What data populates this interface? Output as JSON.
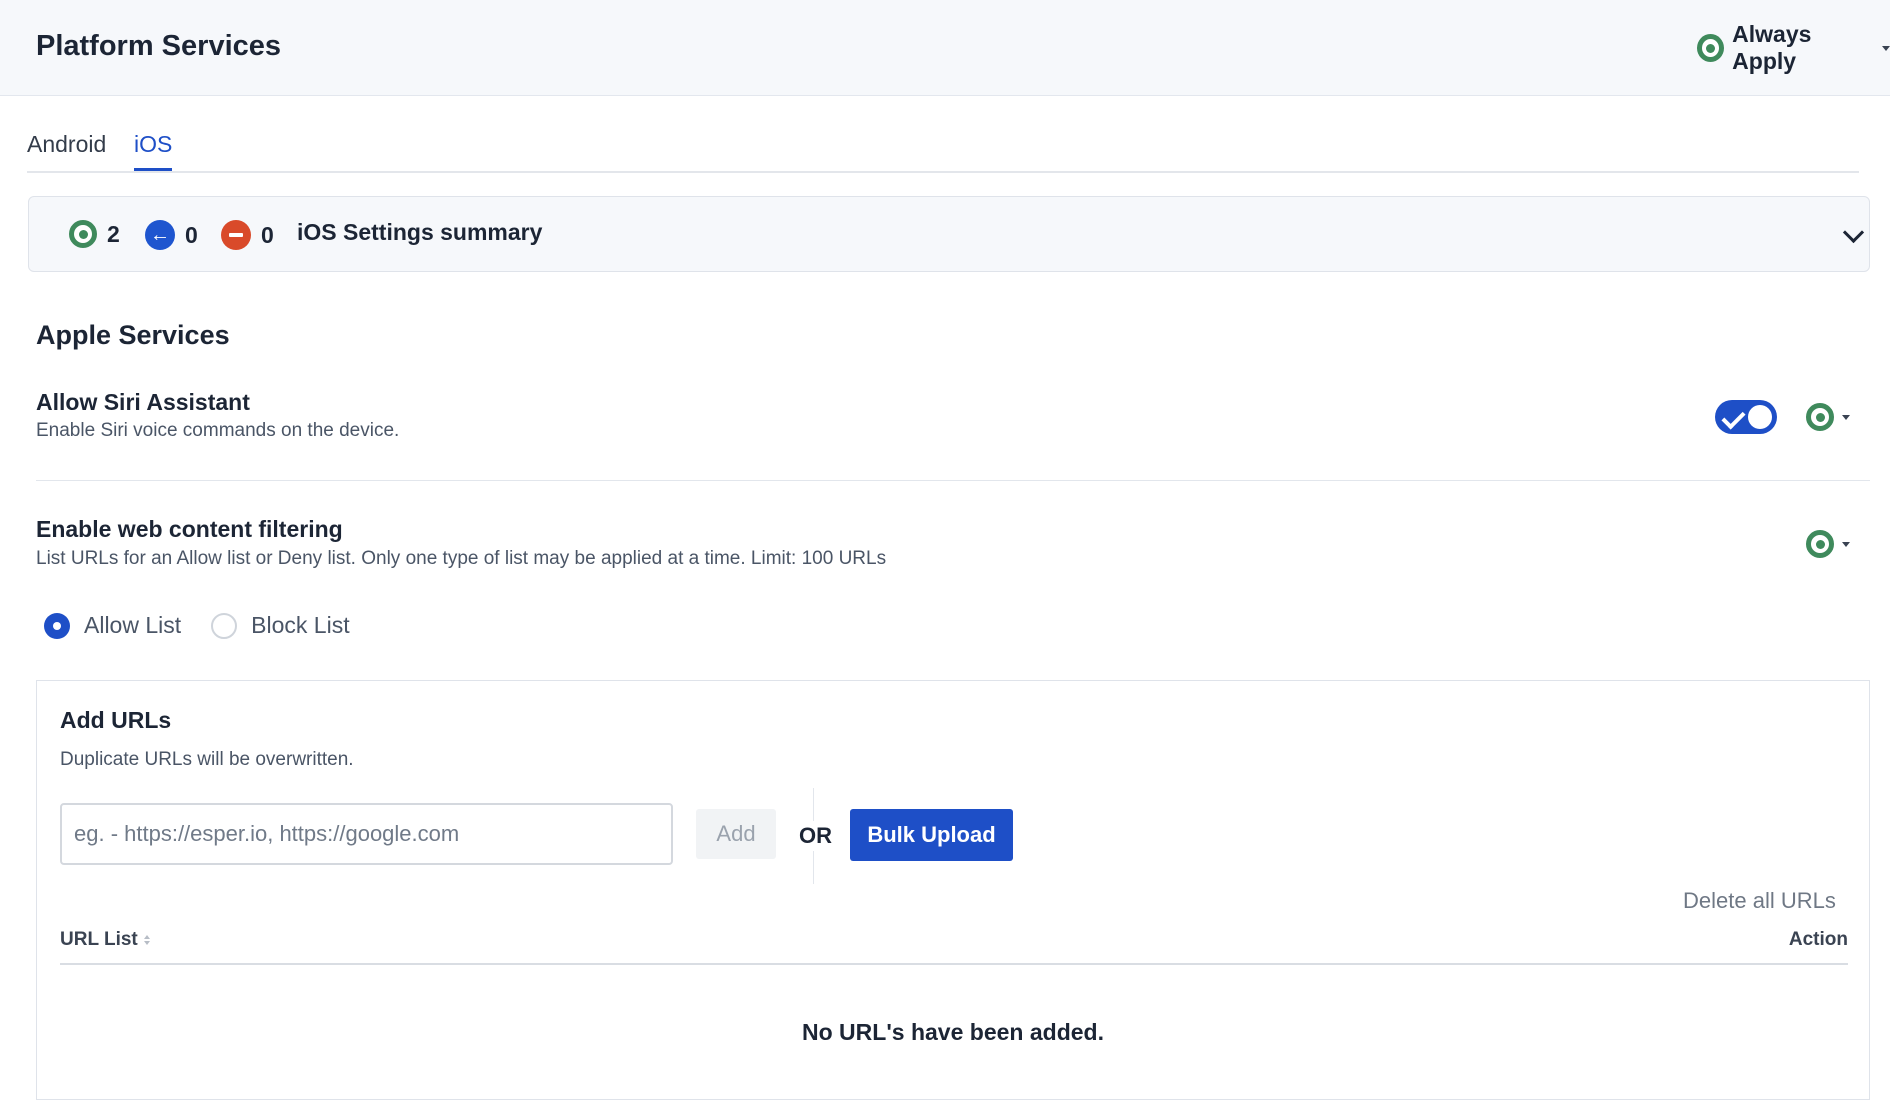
{
  "header": {
    "title": "Platform Services",
    "apply_label": "Always Apply",
    "apply_icon": "green-ring-icon"
  },
  "tabs": [
    {
      "label": "Android",
      "active": false
    },
    {
      "label": "iOS",
      "active": true
    }
  ],
  "summary": {
    "applied_count": "2",
    "inherited_count": "0",
    "blocked_count": "0",
    "title": "iOS Settings summary"
  },
  "section": {
    "title": "Apple Services"
  },
  "settings": [
    {
      "title": "Allow Siri Assistant",
      "description": "Enable Siri voice commands on the device.",
      "toggle_on": true
    },
    {
      "title": "Enable web content filtering",
      "description": "List URLs for an Allow list or Deny list. Only one type of list may be applied at a time. Limit: 100 URLs"
    }
  ],
  "list_type": {
    "options": [
      {
        "label": "Allow List",
        "selected": true
      },
      {
        "label": "Block List",
        "selected": false
      }
    ]
  },
  "url_panel": {
    "title": "Add URLs",
    "description": "Duplicate URLs will be overwritten.",
    "input_placeholder": "eg. - https://esper.io, https://google.com",
    "input_value": "",
    "add_label": "Add",
    "or_label": "OR",
    "bulk_label": "Bulk Upload",
    "delete_all_label": "Delete all URLs",
    "table": {
      "col_url": "URL List",
      "col_action": "Action"
    },
    "empty_message": "No URL's have been added."
  },
  "colors": {
    "accent": "#1e4fc7",
    "applied_green": "#3f8a5c",
    "blocked_red": "#d94a2a"
  }
}
